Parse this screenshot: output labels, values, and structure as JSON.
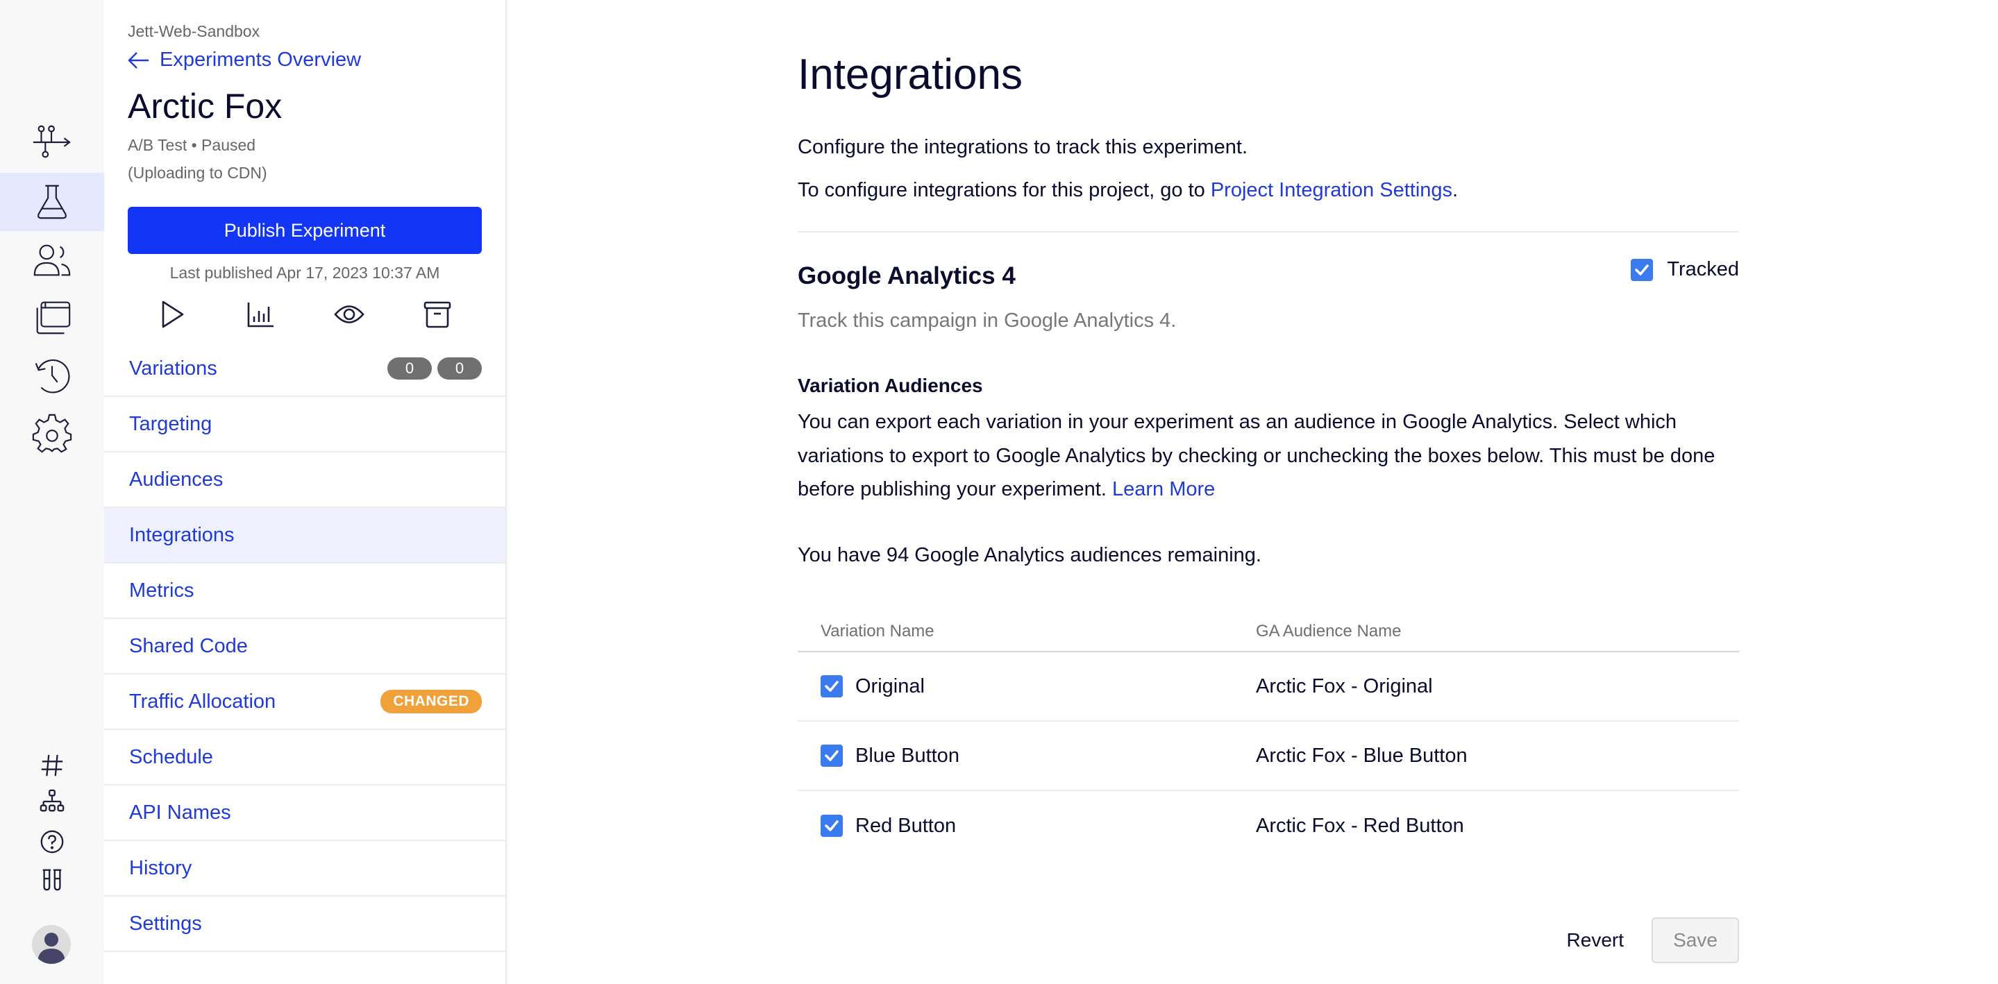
{
  "rail": {
    "top_items": [
      {
        "icon": "flows-icon",
        "active": false
      },
      {
        "icon": "flask-icon",
        "active": true
      },
      {
        "icon": "audiences-icon",
        "active": false
      },
      {
        "icon": "pages-icon",
        "active": false
      },
      {
        "icon": "history-icon",
        "active": false
      },
      {
        "icon": "settings-gear-icon",
        "active": false
      }
    ],
    "bottom_items": [
      {
        "icon": "hash-icon"
      },
      {
        "icon": "hierarchy-icon"
      },
      {
        "icon": "help-icon"
      },
      {
        "icon": "test-tubes-icon"
      }
    ],
    "avatar": "user-avatar"
  },
  "panel": {
    "project_name": "Jett-Web-Sandbox",
    "back_label": "Experiments Overview",
    "experiment_name": "Arctic Fox",
    "experiment_meta": "A/B Test • Paused",
    "upload_status": "(Uploading to CDN)",
    "publish_label": "Publish Experiment",
    "last_published": "Last published Apr 17, 2023 10:37 AM",
    "actions": [
      "play-icon",
      "results-chart-icon",
      "preview-eye-icon",
      "archive-icon"
    ],
    "nav": [
      {
        "label": "Variations",
        "badges": [
          "0",
          "0"
        ]
      },
      {
        "label": "Targeting"
      },
      {
        "label": "Audiences"
      },
      {
        "label": "Integrations",
        "active": true
      },
      {
        "label": "Metrics"
      },
      {
        "label": "Shared Code"
      },
      {
        "label": "Traffic Allocation",
        "tag": "CHANGED"
      },
      {
        "label": "Schedule"
      },
      {
        "label": "API Names"
      },
      {
        "label": "History"
      },
      {
        "label": "Settings"
      }
    ]
  },
  "main": {
    "title": "Integrations",
    "intro": "Configure the integrations to track this experiment.",
    "project_prefix": "To configure integrations for this project, go to ",
    "project_link": "Project Integration Settings",
    "project_suffix": ".",
    "integration": {
      "name": "Google Analytics 4",
      "description": "Track this campaign in Google Analytics 4.",
      "tracked_label": "Tracked",
      "tracked": true
    },
    "variation_audiences": {
      "title": "Variation Audiences",
      "description": "You can export each variation in your experiment as an audience in Google Analytics. Select which variations to export to Google Analytics by checking or unchecking the boxes below. This must be done before publishing your experiment. ",
      "learn_more": "Learn More",
      "remaining": "You have 94 Google Analytics audiences remaining."
    },
    "table": {
      "columns": [
        "Variation Name",
        "GA Audience Name"
      ],
      "rows": [
        {
          "variation": "Original",
          "audience": "Arctic Fox - Original",
          "checked": true
        },
        {
          "variation": "Blue Button",
          "audience": "Arctic Fox - Blue Button",
          "checked": true
        },
        {
          "variation": "Red Button",
          "audience": "Arctic Fox - Red Button",
          "checked": true
        }
      ]
    },
    "revert_label": "Revert",
    "save_label": "Save"
  },
  "colors": {
    "primary": "#1335f5",
    "link": "#1f3ad6",
    "checkbox": "#3b7bf0",
    "changed_badge": "#f0a13a",
    "count_badge": "#707070",
    "active_nav_bg": "#eef1fd"
  }
}
